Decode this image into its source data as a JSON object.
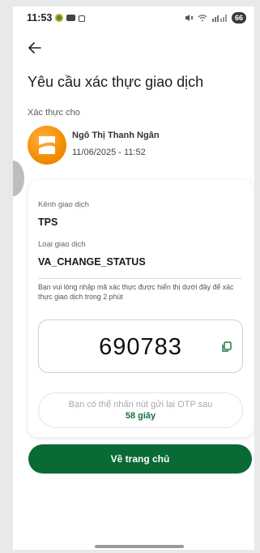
{
  "status_bar": {
    "time": "11:53",
    "battery": "66",
    "icons": [
      "app-badge-icon",
      "mail-icon",
      "lock-icon",
      "mute-icon",
      "wifi-icon",
      "signal-icon",
      "battery-icon"
    ]
  },
  "header": {
    "back_icon": "arrow-left-icon",
    "title": "Yêu cầu xác thực giao dịch"
  },
  "verification": {
    "label": "Xác thực cho",
    "user_name": "Ngô Thị Thanh Ngân",
    "datetime": "11/06/2025 - 11:52"
  },
  "details": {
    "channel_label": "Kênh giao dịch",
    "channel_value": "TPS",
    "type_label": "Loại giao dịch",
    "type_value": "VA_CHANGE_STATUS",
    "instruction": "Bạn vui lòng nhập mã xác thực được hiển thị dưới đây để xác thực giao dịch trong 2 phút"
  },
  "otp": {
    "code": "690783",
    "copy_icon": "copy-icon"
  },
  "resend": {
    "text": "Bạn có thể nhấn nút gửi lại OTP sau",
    "countdown": "58 giây"
  },
  "actions": {
    "home_label": "Về trang chủ"
  },
  "colors": {
    "primary_green": "#0a6a35",
    "countdown_green": "#15713b",
    "avatar_orange": "#f28a00"
  }
}
